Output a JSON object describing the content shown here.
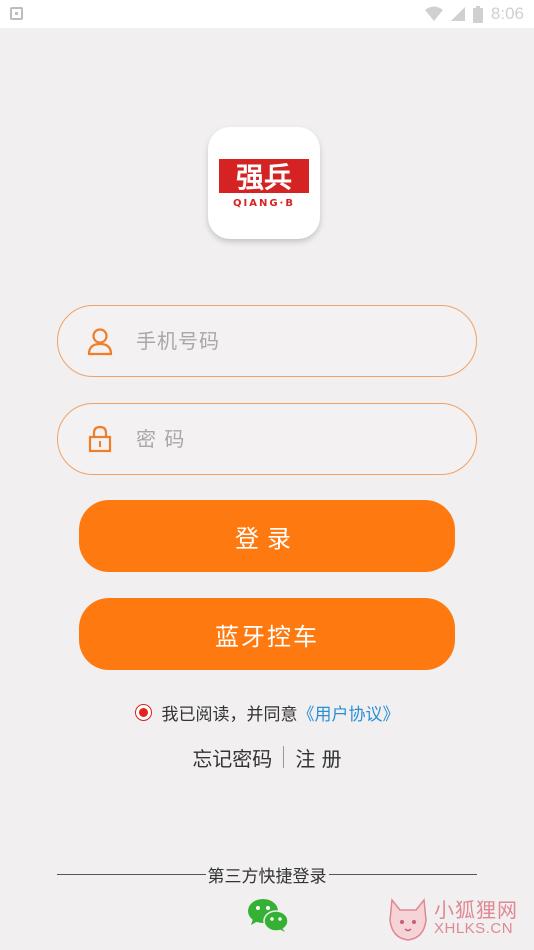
{
  "status_bar": {
    "time": "8:06",
    "icons": [
      "notification-icon",
      "wifi-icon",
      "signal-icon",
      "battery-icon"
    ]
  },
  "logo": {
    "text": "强兵",
    "subtext": "QIANG·B"
  },
  "form": {
    "phone": {
      "placeholder": "手机号码",
      "value": "",
      "icon": "user-icon"
    },
    "password": {
      "placeholder": "密 码",
      "value": "",
      "icon": "lock-icon"
    }
  },
  "buttons": {
    "login": "登录",
    "bluetooth": "蓝牙控车"
  },
  "agreement": {
    "checked": true,
    "text": "我已阅读，并同意",
    "link": "《用户协议》"
  },
  "links": {
    "forgot": "忘记密码",
    "register": "注 册"
  },
  "third_party": {
    "label": "第三方快捷登录",
    "icon": "wechat-icon"
  },
  "watermark": {
    "title": "小狐狸网",
    "url": "XHLKS.CN"
  },
  "colors": {
    "accent": "#fe7a10",
    "field_border": "#f0a266",
    "link": "#2b8fd8",
    "radio": "#e3241b",
    "background": "#f1eff0"
  }
}
